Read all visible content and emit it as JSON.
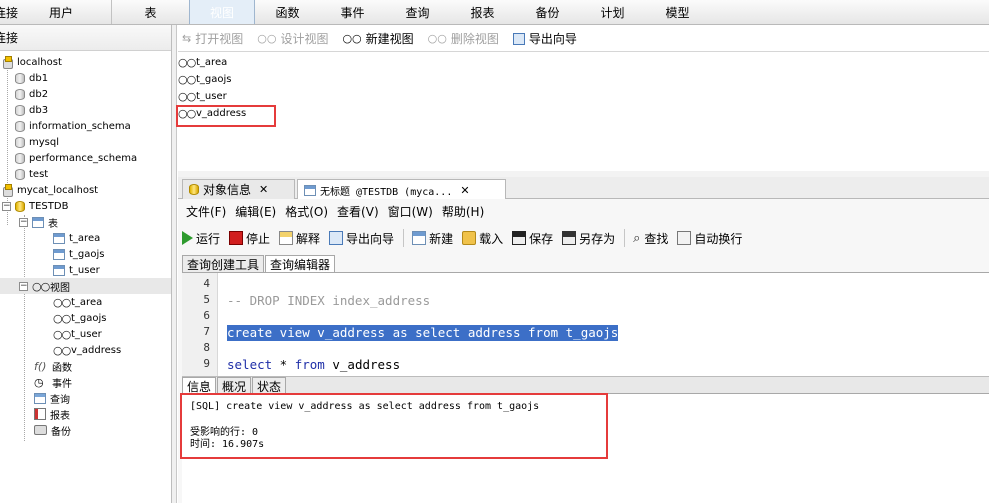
{
  "main_toolbar": {
    "items": [
      "连接",
      "用户",
      "表",
      "视图",
      "函数",
      "事件",
      "查询",
      "报表",
      "备份",
      "计划",
      "模型"
    ],
    "selected": "视图"
  },
  "left_panel": {
    "header": "连接",
    "tree": {
      "localhost": "localhost",
      "localhost_dbs": [
        "db1",
        "db2",
        "db3",
        "information_schema",
        "mysql",
        "performance_schema",
        "test"
      ],
      "mycat": "mycat_localhost",
      "testdb": "TESTDB",
      "tables_label": "表",
      "tables": [
        "t_area",
        "t_gaojs",
        "t_user"
      ],
      "views_label": "视图",
      "views": [
        "t_area",
        "t_gaojs",
        "t_user",
        "v_address"
      ],
      "others": [
        "函数",
        "事件",
        "查询",
        "报表",
        "备份"
      ]
    }
  },
  "object_toolbar": {
    "open": "打开视图",
    "design": "设计视图",
    "new": "新建视图",
    "delete": "删除视图",
    "export": "导出向导"
  },
  "object_list": [
    "t_area",
    "t_gaojs",
    "t_user",
    "v_address"
  ],
  "tabs": {
    "object_info": "对象信息",
    "query": "无标题 @TESTDB (myca..."
  },
  "editor_menu": [
    "文件(F)",
    "编辑(E)",
    "格式(O)",
    "查看(V)",
    "窗口(W)",
    "帮助(H)"
  ],
  "editor_toolbar": {
    "run": "运行",
    "stop": "停止",
    "explain": "解释",
    "export": "导出向导",
    "new": "新建",
    "load": "载入",
    "save": "保存",
    "save_as": "另存为",
    "find": "查找",
    "wrap": "自动换行"
  },
  "sub_tabs": [
    "查询创建工具",
    "查询编辑器"
  ],
  "code": {
    "line_numbers": [
      "4",
      "5",
      "6",
      "7",
      "8",
      "9"
    ],
    "line5": "-- DROP INDEX index_address",
    "line7": "create view v_address as select address from t_gaojs",
    "line9_kw1": "select",
    "line9_mid": " * ",
    "line9_kw2": "from",
    "line9_rest": " v_address"
  },
  "bottom_tabs": [
    "信息",
    "概况",
    "状态"
  ],
  "info": {
    "sql": "[SQL] create view v_address as select address from t_gaojs",
    "affected": "受影响的行: 0",
    "time": "时间: 16.907s"
  },
  "colors": {
    "highlight_box": "#e53b3b",
    "selection": "#3c6fc7",
    "comment": "#9a9a9a"
  }
}
